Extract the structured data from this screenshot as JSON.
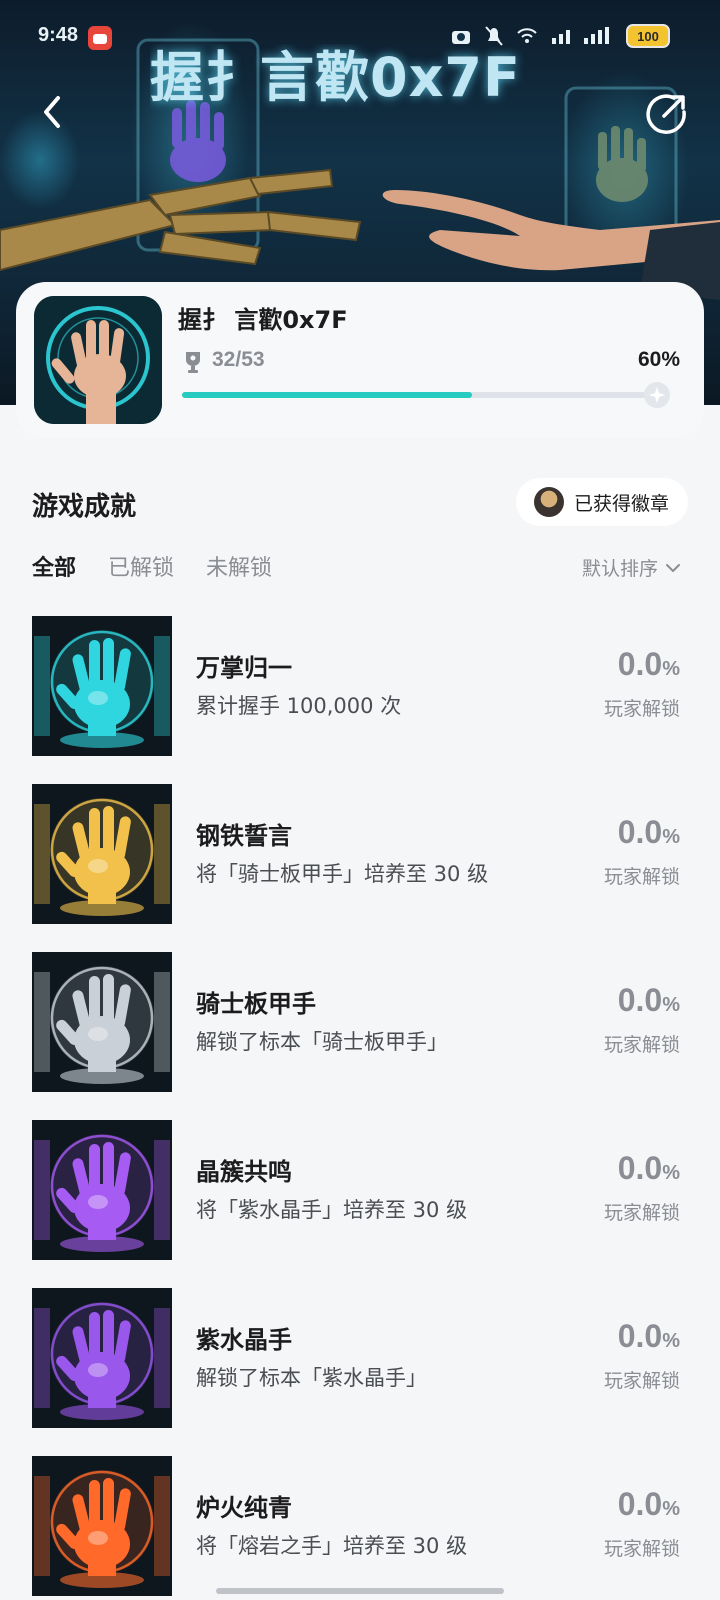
{
  "status_bar": {
    "time": "9:48",
    "battery": "100"
  },
  "hero": {
    "banner_title": "握扌言歡0x7F"
  },
  "game": {
    "name": "握扌 言歡0x7F",
    "trophy_count": "32/53",
    "progress_pct": "60%",
    "progress_fraction": 0.6
  },
  "section": {
    "title": "游戏成就",
    "badge_label": "已获得徽章"
  },
  "tabs": [
    {
      "label": "全部",
      "active": true
    },
    {
      "label": "已解锁",
      "active": false
    },
    {
      "label": "未解锁",
      "active": false
    }
  ],
  "sort": {
    "label": "默认排序"
  },
  "achievements": [
    {
      "title": "万掌归一",
      "desc": "累计握手 100,000 次",
      "rate": "0.0",
      "unit": "%",
      "rate_label": "玩家解锁",
      "theme": "#2fd6e0"
    },
    {
      "title": "钢铁誓言",
      "desc": "将「骑士板甲手」培养至 30 级",
      "rate": "0.0",
      "unit": "%",
      "rate_label": "玩家解锁",
      "theme": "#f2c14b"
    },
    {
      "title": "骑士板甲手",
      "desc": "解锁了标本「骑士板甲手」",
      "rate": "0.0",
      "unit": "%",
      "rate_label": "玩家解锁",
      "theme": "#c9d0d8"
    },
    {
      "title": "晶簇共鸣",
      "desc": "将「紫水晶手」培养至 30 级",
      "rate": "0.0",
      "unit": "%",
      "rate_label": "玩家解锁",
      "theme": "#a65bf2"
    },
    {
      "title": "紫水晶手",
      "desc": "解锁了标本「紫水晶手」",
      "rate": "0.0",
      "unit": "%",
      "rate_label": "玩家解锁",
      "theme": "#9a57ec"
    },
    {
      "title": "炉火纯青",
      "desc": "将「熔岩之手」培养至 30 级",
      "rate": "0.0",
      "unit": "%",
      "rate_label": "玩家解锁",
      "theme": "#ff6a2b"
    }
  ]
}
